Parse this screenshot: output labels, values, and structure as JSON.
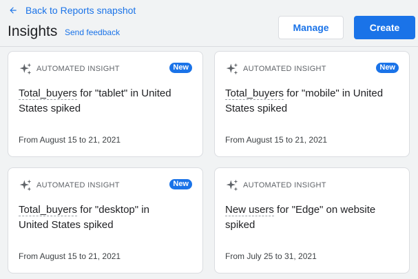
{
  "header": {
    "back_label": "Back to Reports snapshot",
    "title": "Insights",
    "feedback_label": "Send feedback",
    "manage_label": "Manage",
    "create_label": "Create"
  },
  "colors": {
    "accent": "#1a73e8",
    "background": "#f1f3f4",
    "card": "#ffffff"
  },
  "icons": {
    "back": "arrow-left-icon",
    "insight": "sparkle-icon"
  },
  "cards": [
    {
      "type_label": "AUTOMATED INSIGHT",
      "badge": "New",
      "metric": "Total_buyers",
      "rest": " for \"tablet\" in United States spiked",
      "date": "From August 15 to 21, 2021"
    },
    {
      "type_label": "AUTOMATED INSIGHT",
      "badge": "New",
      "metric": "Total_buyers",
      "rest": " for \"mobile\" in United States spiked",
      "date": "From August 15 to 21, 2021"
    },
    {
      "type_label": "AUTOMATED INSIGHT",
      "badge": "New",
      "metric": "Total_buyers",
      "rest": " for \"desktop\" in United States spiked",
      "date": "From August 15 to 21, 2021"
    },
    {
      "type_label": "AUTOMATED INSIGHT",
      "metric": "New users",
      "rest": " for \"Edge\" on website spiked",
      "date": "From July 25 to 31, 2021"
    }
  ]
}
